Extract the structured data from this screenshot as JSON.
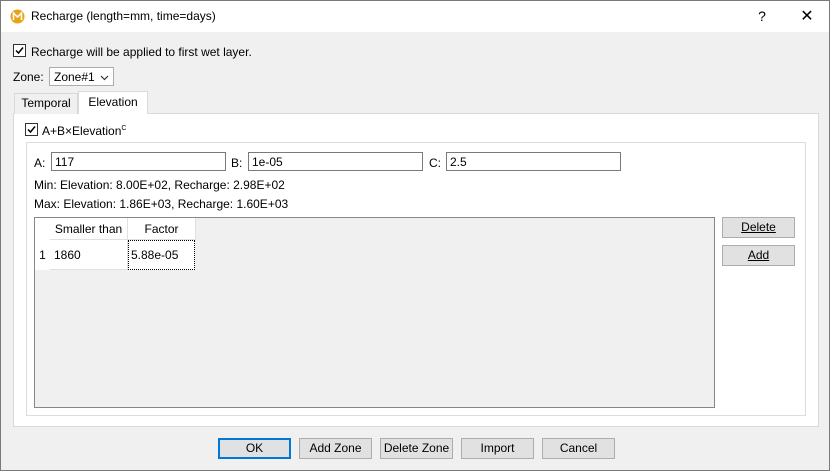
{
  "window": {
    "title": "Recharge (length=mm, time=days)",
    "help_label": "?",
    "close_label": "✕"
  },
  "apply_first_wet_layer": {
    "label": "Recharge will be applied to first wet layer.",
    "checked": true
  },
  "zone": {
    "label": "Zone:",
    "selected": "Zone#1"
  },
  "tabs": [
    {
      "label": "Temporal",
      "active": false
    },
    {
      "label": "Elevation",
      "active": true
    }
  ],
  "elevation": {
    "formula_prefix": "A+B×Elevation",
    "formula_exponent": "C",
    "formula_checked": true,
    "a_label": "A:",
    "a_value": "117",
    "b_label": "B:",
    "b_value": "1e-05",
    "c_label": "C:",
    "c_value": "2.5",
    "min_line": "Min: Elevation: 8.00E+02,  Recharge: 2.98E+02",
    "max_line": "Max: Elevation: 1.86E+03,  Recharge: 1.60E+03"
  },
  "grid": {
    "columns": [
      "Smaller than",
      "Factor"
    ],
    "rows": [
      {
        "num": "1",
        "smaller_than": "1860",
        "factor": "5.88e-05"
      }
    ]
  },
  "side_buttons": {
    "delete_label": "Delete",
    "add_label": "Add"
  },
  "footer_buttons": {
    "ok_label": "OK",
    "add_zone_label": "Add Zone",
    "delete_zone_label": "Delete Zone",
    "import_label": "Import",
    "cancel_label": "Cancel"
  },
  "icons": {
    "app": "app-logo-icon",
    "check": "checkmark-icon",
    "dropdown": "chevron-down-icon"
  }
}
